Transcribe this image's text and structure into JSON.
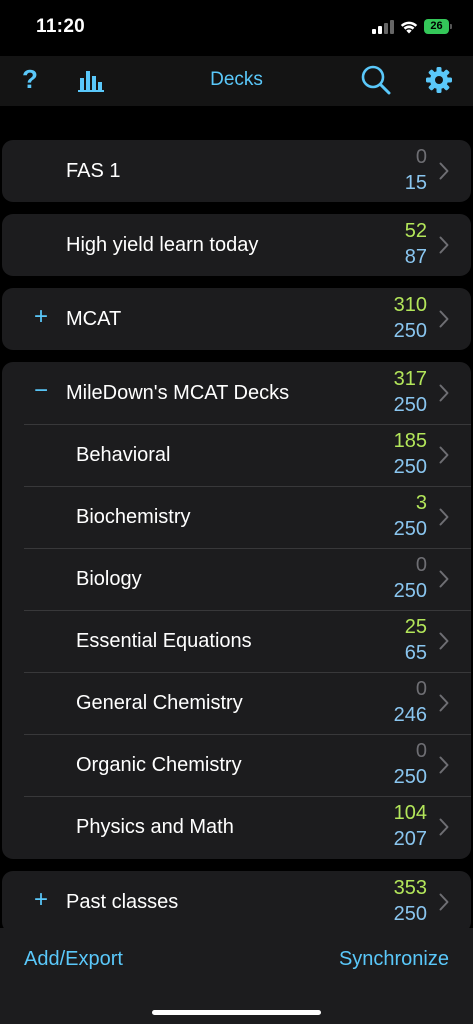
{
  "status_bar": {
    "time": "11:20",
    "battery": "26"
  },
  "nav": {
    "title": "Decks",
    "help_icon": "question-icon",
    "stats_icon": "bar-chart-icon",
    "search_icon": "search-icon",
    "settings_icon": "gear-icon"
  },
  "colors": {
    "accent": "#5ac8fa",
    "new_positive": "#b3e65a",
    "new_zero": "#6e6e73",
    "due": "#8ac6f0",
    "card_bg": "#1c1c1e"
  },
  "decks": [
    {
      "name": "FAS 1",
      "toggle": "",
      "new": "0",
      "due": "15",
      "new_color": "#6e6e73"
    },
    {
      "name": "High yield learn today",
      "toggle": "",
      "new": "52",
      "due": "87",
      "new_color": "#b3e65a"
    },
    {
      "name": "MCAT",
      "toggle": "+",
      "new": "310",
      "due": "250",
      "new_color": "#b3e65a"
    },
    {
      "name": "MileDown's MCAT Decks",
      "toggle": "−",
      "new": "317",
      "due": "250",
      "new_color": "#b3e65a",
      "children": [
        {
          "name": "Behavioral",
          "new": "185",
          "due": "250",
          "new_color": "#b3e65a"
        },
        {
          "name": "Biochemistry",
          "new": "3",
          "due": "250",
          "new_color": "#b3e65a"
        },
        {
          "name": "Biology",
          "new": "0",
          "due": "250",
          "new_color": "#6e6e73"
        },
        {
          "name": "Essential Equations",
          "new": "25",
          "due": "65",
          "new_color": "#b3e65a"
        },
        {
          "name": "General Chemistry",
          "new": "0",
          "due": "246",
          "new_color": "#6e6e73"
        },
        {
          "name": "Organic Chemistry",
          "new": "0",
          "due": "250",
          "new_color": "#6e6e73"
        },
        {
          "name": "Physics and Math",
          "new": "104",
          "due": "207",
          "new_color": "#b3e65a"
        }
      ]
    },
    {
      "name": "Past classes",
      "toggle": "+",
      "new": "353",
      "due": "250",
      "new_color": "#b3e65a"
    }
  ],
  "toolbar": {
    "add_export": "Add/Export",
    "synchronize": "Synchronize"
  }
}
